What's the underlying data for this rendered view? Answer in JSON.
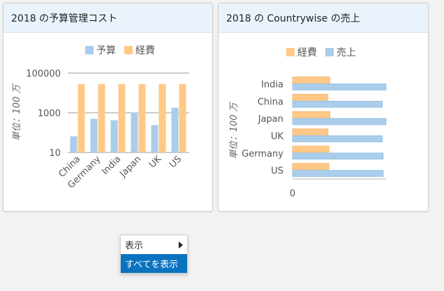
{
  "cards": [
    {
      "title": "2018 の予算管理コスト",
      "legend": [
        {
          "label": "予算",
          "color": "#a9cdea"
        },
        {
          "label": "経費",
          "color": "#ffc887"
        }
      ]
    },
    {
      "title": "2018 の Countrywise の売上",
      "legend": [
        {
          "label": "経費",
          "color": "#ffc887"
        },
        {
          "label": "売上",
          "color": "#a9cdea"
        }
      ]
    }
  ],
  "chart_data": [
    {
      "type": "bar",
      "orientation": "vertical",
      "log_scale": true,
      "categories": [
        "China",
        "Germany",
        "India",
        "Japan",
        "UK",
        "US"
      ],
      "series": [
        {
          "name": "予算",
          "color": "#a9cdea",
          "values": [
            65,
            500,
            420,
            1050,
            240,
            1800
          ]
        },
        {
          "name": "経費",
          "color": "#ffc887",
          "values": [
            28000,
            28000,
            28000,
            28000,
            28000,
            28000
          ]
        }
      ],
      "yticks": [
        "10",
        "1000",
        "100000"
      ],
      "ylim": [
        10,
        100000
      ],
      "ylabel": "単位：100 万",
      "grid": true,
      "legend_position": "top"
    },
    {
      "type": "bar",
      "orientation": "horizontal",
      "categories": [
        "India",
        "China",
        "Japan",
        "UK",
        "Germany",
        "US"
      ],
      "series": [
        {
          "name": "経費",
          "color": "#ffc887",
          "values": [
            40,
            38,
            40,
            38,
            39,
            39
          ]
        },
        {
          "name": "売上",
          "color": "#a9cdea",
          "values": [
            100,
            96,
            100,
            96,
            97,
            97
          ]
        }
      ],
      "xticks": [
        "0"
      ],
      "xlim": [
        0,
        100
      ],
      "ylabel": "単位：100 万",
      "grid": false,
      "legend_position": "top"
    }
  ],
  "context_menu": {
    "items": [
      {
        "label": "表示",
        "has_submenu": true
      },
      {
        "label": "すべてを表示",
        "selected": true
      }
    ]
  }
}
